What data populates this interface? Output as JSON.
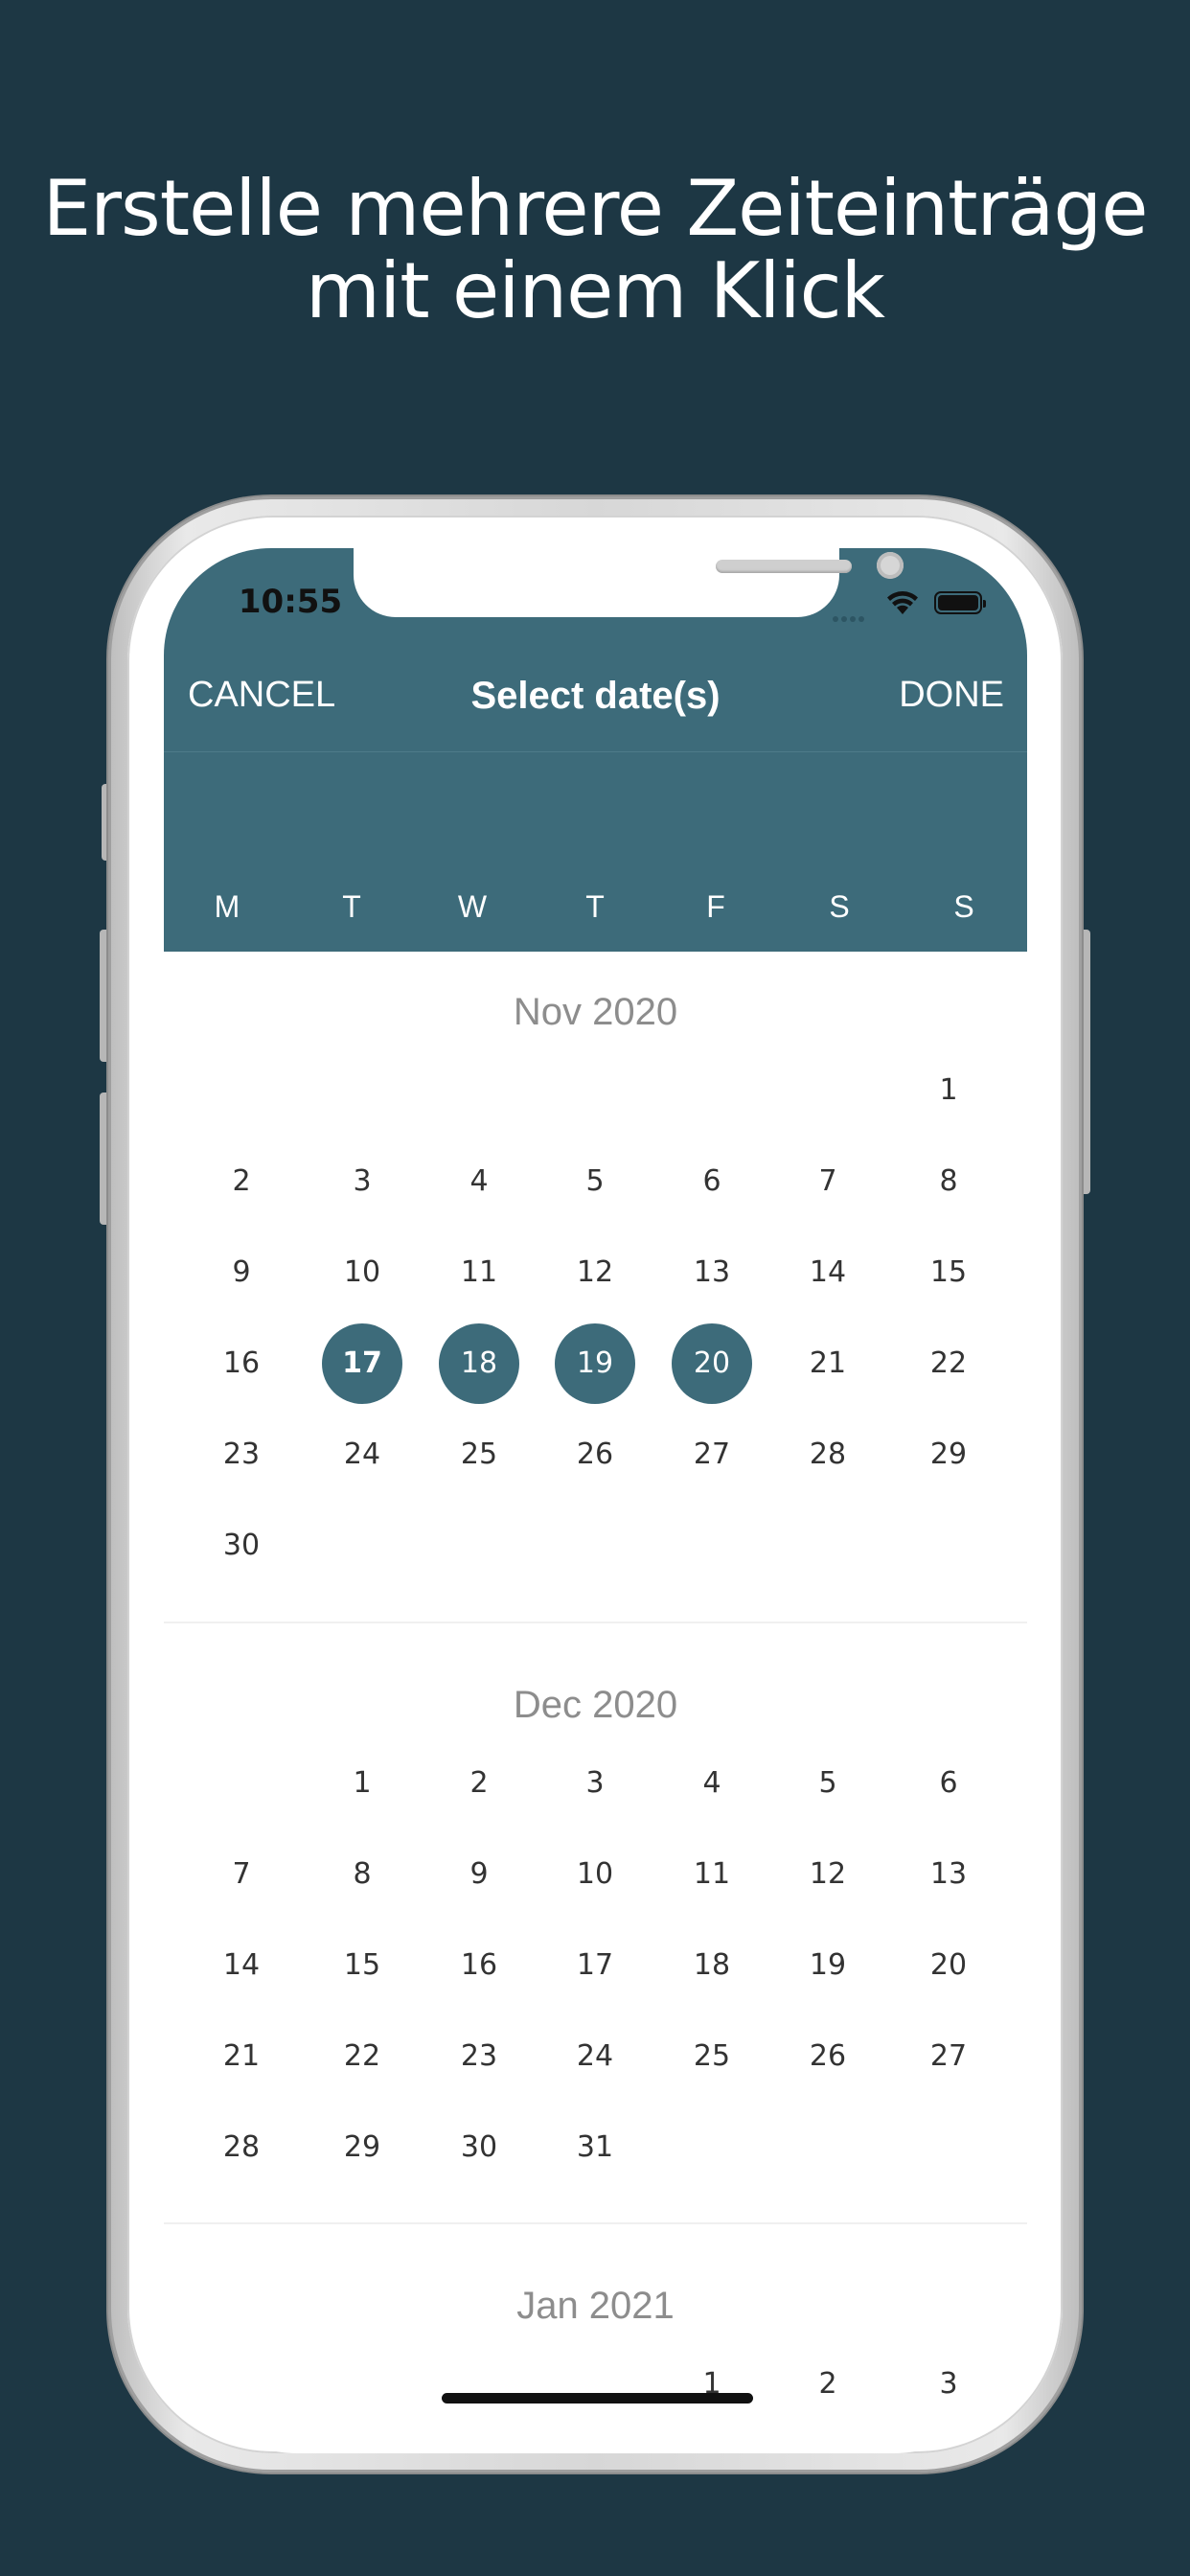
{
  "headline": [
    "Erstelle mehrere Zeiteinträge",
    "mit einem Klick"
  ],
  "status_bar": {
    "time": "10:55"
  },
  "nav": {
    "cancel": "CANCEL",
    "title": "Select date(s)",
    "done": "DONE"
  },
  "weekdays": [
    "M",
    "T",
    "W",
    "T",
    "F",
    "S",
    "S"
  ],
  "months": [
    {
      "title": "Nov 2020",
      "first_weekday_index": 6,
      "days": 30,
      "selected": [
        17,
        18,
        19,
        20
      ],
      "today": 17
    },
    {
      "title": "Dec 2020",
      "first_weekday_index": 1,
      "days": 31,
      "selected": []
    },
    {
      "title": "Jan 2021",
      "first_weekday_index": 4,
      "days": 3,
      "selected": []
    }
  ],
  "colors": {
    "accent": "#3d6b7a",
    "background": "#1d3744"
  }
}
